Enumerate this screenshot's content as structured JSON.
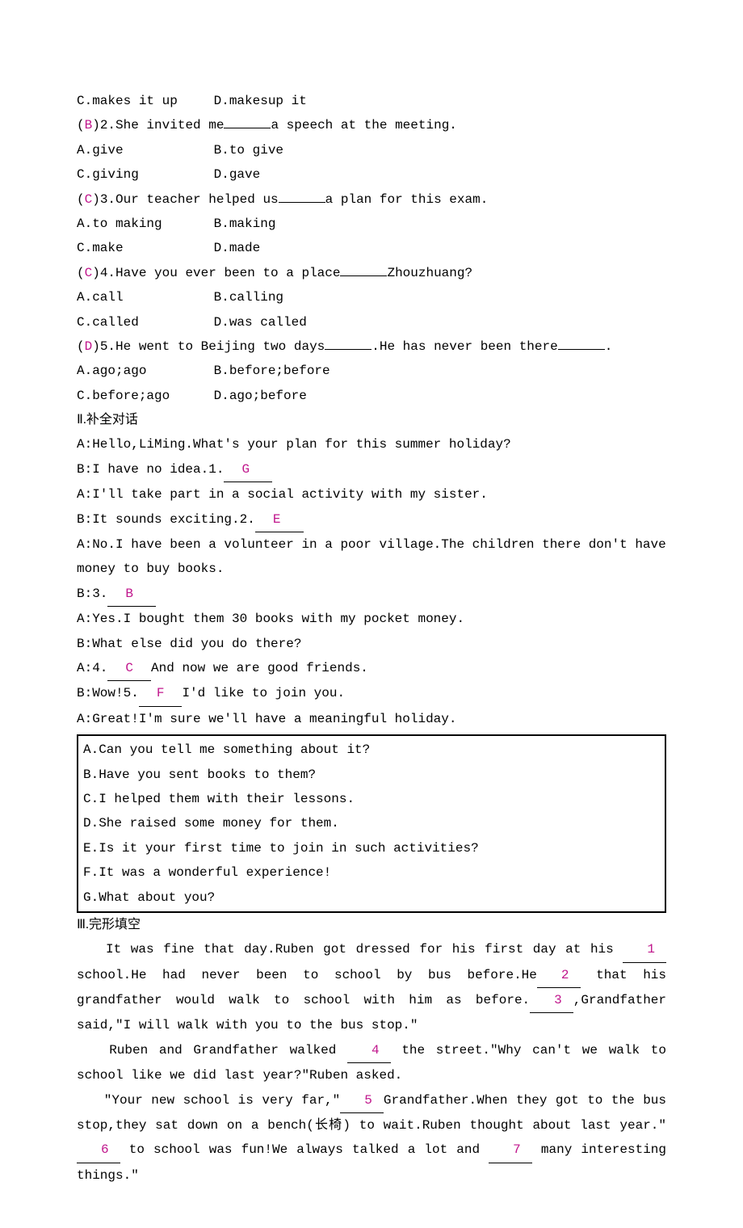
{
  "q1": {
    "optC": "C.makes it up",
    "optD": "D.makesup it"
  },
  "q2": {
    "ans": "B",
    "pre": ")2.She invited me",
    "post": "a speech at the meeting.",
    "A": "A.give",
    "B": "B.to give",
    "C": "C.giving",
    "D": "D.gave"
  },
  "q3": {
    "ans": "C",
    "pre": ")3.Our teacher helped us",
    "post": "a plan for this exam.",
    "A": "A.to making",
    "B": "B.making",
    "C": "C.make",
    "D": "D.made"
  },
  "q4": {
    "ans": "C",
    "pre": ")4.Have you ever been to a place",
    "post": "Zhouzhuang?",
    "A": "A.call",
    "B": "B.calling",
    "C": "C.called",
    "D": "D.was called"
  },
  "q5": {
    "ans": "D",
    "pre": ")5.He went to Beijing two days",
    "mid": ".He has never been there",
    "post": ".",
    "A": "A.ago;ago",
    "B": "B.before;before",
    "C": "C.before;ago",
    "D": "D.ago;before"
  },
  "sec2": {
    "title": "Ⅱ.补全对话",
    "l1": "A:Hello,LiMing.What's your plan for this summer holiday?",
    "l2a": "B:I have no idea.1.",
    "a1": "G",
    "l3": "A:I'll take part in a social activity with my sister.",
    "l4a": "B:It sounds exciting.2.",
    "a2": "E",
    "l5": "A:No.I have been a volunteer in a poor village.The children there don't have money to buy books.",
    "l6a": "B:3.",
    "a3": "B",
    "l7": "A:Yes.I bought them 30 books with my pocket money.",
    "l8": "B:What else did you do there?",
    "l9a": "A:4.",
    "a4": "C",
    "l9b": "And now we are good friends.",
    "l10a": "B:Wow!5.",
    "a5": "F",
    "l10b": "I'd like to join you.",
    "l11": "A:Great!I'm sure we'll have a meaningful holiday.",
    "box": {
      "A": "A.Can you tell me something about it?",
      "B": "B.Have you sent books to them?",
      "C": "C.I helped them with their lessons.",
      "D": "D.She raised some money for them.",
      "E": "E.Is it your first time to join in such activities?",
      "F": "F.It was a wonderful experience!",
      "G": "G.What about you?"
    }
  },
  "sec3": {
    "title": "Ⅲ.完形填空",
    "p1a": "It was fine that day.Ruben got dressed for his first day at his ",
    "b1": "1",
    "p1b": "school.He had never been to school by bus before.He",
    "b2": "2",
    "p1c": " that his grandfather would walk to school with him as before.",
    "b3": "3",
    "p1d": ",Grandfather said,\"I will walk with you to the bus stop.\"",
    "p2a": "Ruben and Grandfather walked ",
    "b4": "4",
    "p2b": " the street.\"Why can't we walk to school like we did last year?\"Ruben asked.",
    "p3a": "\"Your new school is very far,\"",
    "b5": "5",
    "p3b": "Grandfather.When they got to the bus stop,they sat down on a bench(长椅) to wait.Ruben thought about last year.\"",
    "b6": "6",
    "p3c": " to school was fun!We always talked a lot and ",
    "b7": "7",
    "p3d": " many interesting things.\""
  }
}
